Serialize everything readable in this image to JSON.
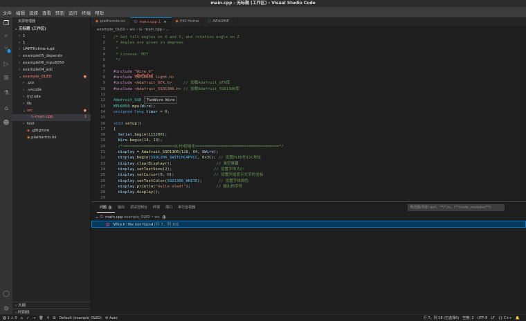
{
  "window": {
    "title": "main.cpp - 无标题 (工作区) - Visual Studio Code"
  },
  "menu": [
    "文件",
    "编辑",
    "选择",
    "查看",
    "转到",
    "运行",
    "终端",
    "帮助"
  ],
  "activity": {
    "scm_badge": "1"
  },
  "sidebar": {
    "header": "资源管理器",
    "items": [
      {
        "label": "无标题 (工作区)",
        "chev": "⌄",
        "indent": 0,
        "bold": true
      },
      {
        "label": "1",
        "chev": "›",
        "indent": 1
      },
      {
        "label": "1",
        "chev": "›",
        "indent": 1
      },
      {
        "label": "UARTRxInterrupt",
        "chev": "›",
        "indent": 1
      },
      {
        "label": "example05_depends",
        "chev": "›",
        "indent": 1
      },
      {
        "label": "example06_mpu6050",
        "chev": "›",
        "indent": 1
      },
      {
        "label": "example04_adc",
        "chev": "›",
        "indent": 1
      },
      {
        "label": "example_OLED",
        "chev": "⌄",
        "indent": 1,
        "red": true,
        "dot": "●"
      },
      {
        "label": ".pio",
        "chev": "›",
        "indent": 2
      },
      {
        "label": ".vscode",
        "chev": "›",
        "indent": 2
      },
      {
        "label": "include",
        "chev": "›",
        "indent": 2
      },
      {
        "label": "lib",
        "chev": "›",
        "indent": 2
      },
      {
        "label": "src",
        "chev": "⌄",
        "indent": 2,
        "red": true,
        "dot": "●"
      },
      {
        "label": "main.cpp",
        "chev": "",
        "indent": 3,
        "red": true,
        "dot": "1",
        "selected": true,
        "icon": "G·"
      },
      {
        "label": "test",
        "chev": "›",
        "indent": 2
      },
      {
        "label": ".gitignore",
        "chev": "",
        "indent": 2,
        "icon": "◆"
      },
      {
        "label": "platformio.ini",
        "chev": "",
        "indent": 2,
        "icon": "◉"
      }
    ],
    "outline": "大纲",
    "timeline": "时间线"
  },
  "tabs": [
    {
      "label": "platformio.ini",
      "icon": "◉",
      "active": false
    },
    {
      "label": "main.cpp 1",
      "icon": "G·",
      "active": true
    },
    {
      "label": "PIO Home",
      "icon": "◉",
      "active": false
    },
    {
      "label": "README",
      "icon": "ⓘ",
      "active": false
    }
  ],
  "breadcrumb": "example_OLED › src › G· main.cpp › ...",
  "code": [
    {
      "n": "1",
      "tokens": [
        [
          "c-com",
          "/* Get tilt angles on X and Y, and rotation angle on Z"
        ]
      ]
    },
    {
      "n": "2",
      "tokens": [
        [
          "c-com",
          " * Angles are given in degrees"
        ]
      ]
    },
    {
      "n": "3",
      "tokens": [
        [
          "c-com",
          " *"
        ]
      ]
    },
    {
      "n": "4",
      "tokens": [
        [
          "c-com",
          " * License: MIT"
        ]
      ]
    },
    {
      "n": "5",
      "tokens": [
        [
          "c-com",
          " */"
        ]
      ]
    },
    {
      "n": "6",
      "tokens": []
    },
    {
      "n": "7",
      "tokens": [
        [
          "c-pre",
          "#include "
        ],
        [
          "c-str squiggle",
          "\"Wire.h\""
        ]
      ]
    },
    {
      "n": "8",
      "tokens": [
        [
          "c-pre",
          "#include "
        ],
        [
          "c-str",
          "<MPU6050_light.h>"
        ]
      ]
    },
    {
      "n": "9",
      "tokens": [
        [
          "c-pre",
          "#include "
        ],
        [
          "c-str",
          "<Adafruit_GFX.h>"
        ],
        [
          "",
          "     "
        ],
        [
          "c-com",
          "// 加载Adafruit_GFX库"
        ]
      ]
    },
    {
      "n": "10",
      "tokens": [
        [
          "c-pre",
          "#include "
        ],
        [
          "c-str",
          "<Adafruit_SSD1306.h>"
        ],
        [
          "",
          " "
        ],
        [
          "c-com",
          "// 加载Adafruit_SSD1306库"
        ]
      ]
    },
    {
      "n": "11",
      "tokens": []
    },
    {
      "n": "12",
      "tokens": [
        [
          "c-ty",
          "Adafruit_SSD"
        ]
      ]
    },
    {
      "n": "13",
      "tokens": [
        [
          "c-ty",
          "MPU6050"
        ],
        [
          "",
          " "
        ],
        [
          "c-fn",
          "mpu"
        ],
        [
          "",
          "("
        ],
        [
          "c-var",
          "Wire"
        ],
        [
          "",
          ");"
        ]
      ]
    },
    {
      "n": "14",
      "tokens": [
        [
          "c-kw",
          "unsigned long"
        ],
        [
          "",
          " "
        ],
        [
          "c-var",
          "timer"
        ],
        [
          "",
          " = "
        ],
        [
          "c-num",
          "0"
        ],
        [
          "",
          ";"
        ]
      ]
    },
    {
      "n": "15",
      "tokens": []
    },
    {
      "n": "16",
      "tokens": [
        [
          "c-kw",
          "void"
        ],
        [
          "",
          " "
        ],
        [
          "c-fn",
          "setup"
        ],
        [
          "",
          "()"
        ]
      ]
    },
    {
      "n": "17",
      "tokens": [
        [
          "",
          "{"
        ]
      ]
    },
    {
      "n": "18",
      "tokens": [
        [
          "",
          "  "
        ],
        [
          "c-var",
          "Serial"
        ],
        [
          "",
          "."
        ],
        [
          "c-fn",
          "begin"
        ],
        [
          "",
          "("
        ],
        [
          "c-num",
          "115200"
        ],
        [
          "",
          ");"
        ]
      ]
    },
    {
      "n": "19",
      "tokens": [
        [
          "",
          "  "
        ],
        [
          "c-var",
          "Wire"
        ],
        [
          "",
          "."
        ],
        [
          "c-fn",
          "begin"
        ],
        [
          "",
          "("
        ],
        [
          "c-num",
          "18"
        ],
        [
          "",
          ", "
        ],
        [
          "c-num",
          "19"
        ],
        [
          "",
          ");"
        ]
      ]
    },
    {
      "n": "20",
      "tokens": [
        [
          "",
          "  "
        ],
        [
          "c-com",
          "/*======================OLED初始化====================================*/"
        ]
      ]
    },
    {
      "n": "21",
      "tokens": [
        [
          "",
          "  "
        ],
        [
          "c-var",
          "display"
        ],
        [
          "",
          " = "
        ],
        [
          "c-fn",
          "Adafruit_SSD1306"
        ],
        [
          "",
          "("
        ],
        [
          "c-num",
          "128"
        ],
        [
          "",
          ", "
        ],
        [
          "c-num",
          "64"
        ],
        [
          "",
          ", &"
        ],
        [
          "c-var",
          "Wire"
        ],
        [
          "",
          ");"
        ]
      ]
    },
    {
      "n": "22",
      "tokens": [
        [
          "",
          "  "
        ],
        [
          "c-var",
          "display"
        ],
        [
          "",
          "."
        ],
        [
          "c-fn",
          "begin"
        ],
        [
          "",
          "("
        ],
        [
          "c-const",
          "SSD1306_SWITCHCAPVCC"
        ],
        [
          "",
          ", "
        ],
        [
          "c-num",
          "0x3C"
        ],
        [
          "",
          "); "
        ],
        [
          "c-com",
          "// 设置OLED的I2C地址"
        ]
      ]
    },
    {
      "n": "23",
      "tokens": [
        [
          "",
          "  "
        ],
        [
          "c-var",
          "display"
        ],
        [
          "",
          "."
        ],
        [
          "c-fn",
          "clearDisplay"
        ],
        [
          "",
          "();                   "
        ],
        [
          "c-com",
          "// 清空屏幕"
        ]
      ]
    },
    {
      "n": "24",
      "tokens": [
        [
          "",
          "  "
        ],
        [
          "c-var",
          "display"
        ],
        [
          "",
          "."
        ],
        [
          "c-fn",
          "setTextSize"
        ],
        [
          "",
          "("
        ],
        [
          "c-num",
          "2"
        ],
        [
          "",
          ");                  "
        ],
        [
          "c-com",
          "// 设置字体大小"
        ]
      ]
    },
    {
      "n": "25",
      "tokens": [
        [
          "",
          "  "
        ],
        [
          "c-var",
          "display"
        ],
        [
          "",
          "."
        ],
        [
          "c-fn",
          "setCursor"
        ],
        [
          "",
          "("
        ],
        [
          "c-num",
          "0"
        ],
        [
          "",
          ", "
        ],
        [
          "c-num",
          "0"
        ],
        [
          "",
          ");                 "
        ],
        [
          "c-com",
          "// 设置开始显示文字的坐标"
        ]
      ]
    },
    {
      "n": "26",
      "tokens": [
        [
          "",
          "  "
        ],
        [
          "c-var",
          "display"
        ],
        [
          "",
          "."
        ],
        [
          "c-fn",
          "setTextColor"
        ],
        [
          "",
          "("
        ],
        [
          "c-const",
          "SSD1306_WHITE"
        ],
        [
          "",
          ");       "
        ],
        [
          "c-com",
          "// 设置字体颜色"
        ]
      ]
    },
    {
      "n": "27",
      "tokens": [
        [
          "",
          "  "
        ],
        [
          "c-var",
          "display"
        ],
        [
          "",
          "."
        ],
        [
          "c-fn",
          "println"
        ],
        [
          "",
          "("
        ],
        [
          "c-str",
          "\"hello oled!\""
        ],
        [
          "",
          ");           "
        ],
        [
          "c-com",
          "// 输出的字符"
        ]
      ]
    },
    {
      "n": "28",
      "tokens": [
        [
          "",
          "  "
        ],
        [
          "c-var",
          "display"
        ],
        [
          "",
          "."
        ],
        [
          "c-fn",
          "display"
        ],
        [
          "",
          "();"
        ]
      ]
    },
    {
      "n": "29",
      "tokens": []
    }
  ],
  "hover": "TwoWire Wire",
  "panel": {
    "tabs": [
      {
        "label": "问题",
        "badge": "1",
        "active": true
      },
      {
        "label": "输出"
      },
      {
        "label": "调试控制台"
      },
      {
        "label": "终端"
      },
      {
        "label": "端口"
      },
      {
        "label": "串行监视器"
      }
    ],
    "filter_placeholder": "筛选器(例如 text、**/*.ts、!**/node_modules/**)",
    "file": {
      "name": "main.cpp",
      "path": "example_OLED • src",
      "count": "1"
    },
    "problem": {
      "message": "'Wire.h' file not found",
      "location": "[行 7，列 10]"
    }
  },
  "status": {
    "left": [
      "⨂ 1 ⚠ 0",
      "⌂",
      "✓",
      "→",
      "🗑",
      "⚲",
      "⊞",
      "Default (example_OLED)",
      "⚙ Auto"
    ],
    "right": [
      "行 7，列 18 (已选择6)",
      "空格: 2",
      "UTF-8",
      "LF",
      "{} C++",
      "🔔"
    ]
  }
}
